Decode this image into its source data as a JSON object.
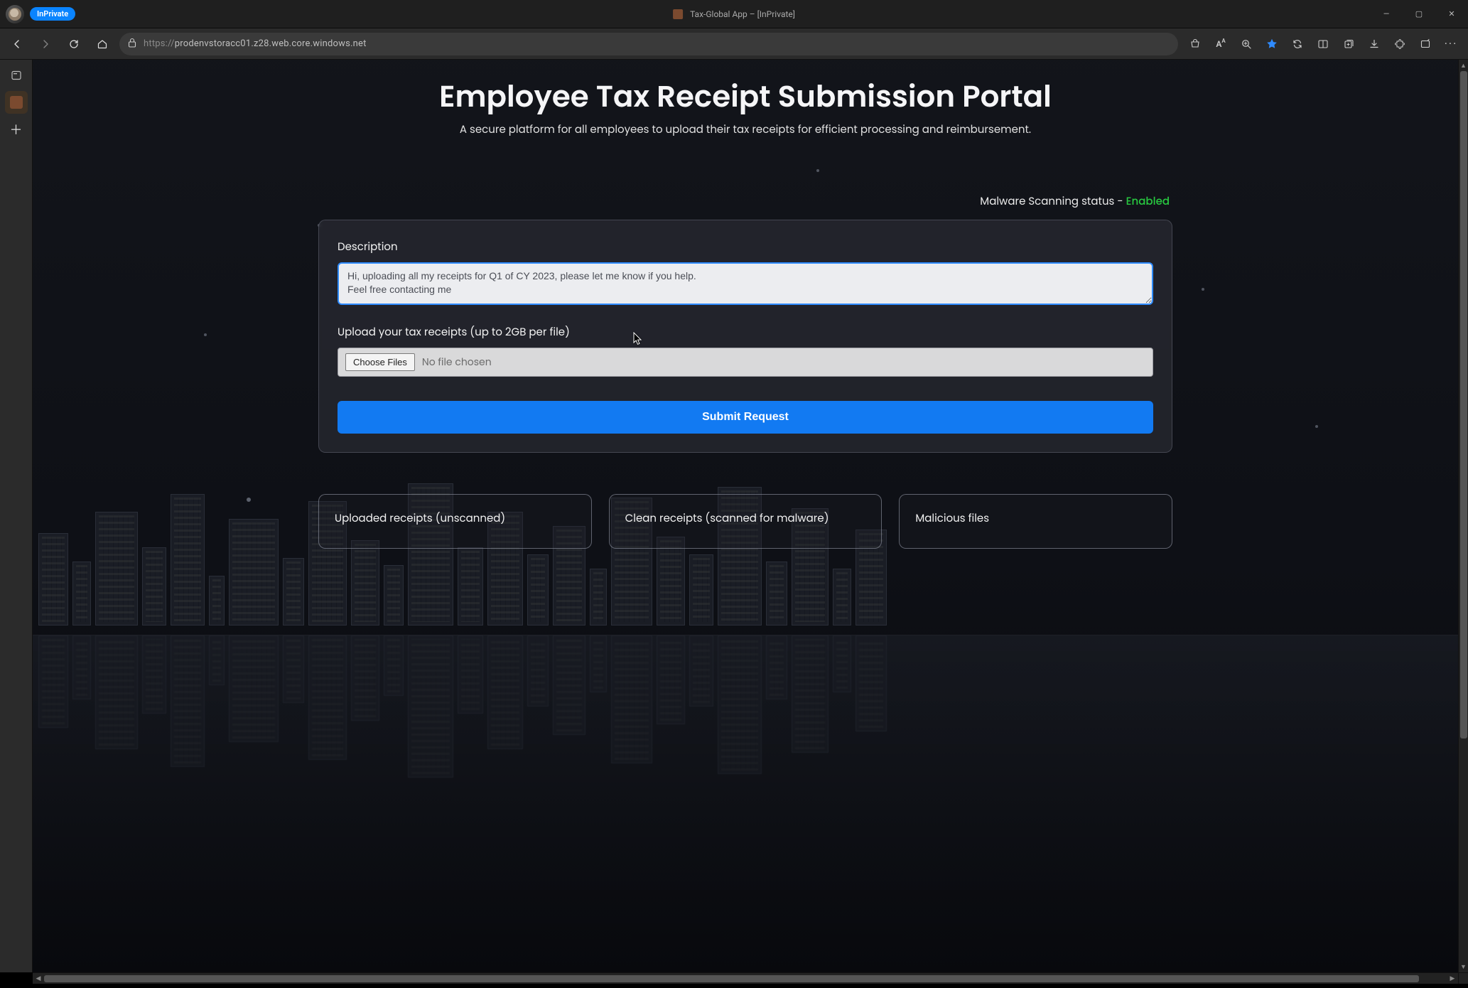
{
  "window": {
    "inprivate_label": "InPrivate",
    "tab_title": "Tax-Global App – [InPrivate]",
    "controls": {
      "minimize": "—",
      "maximize": "▢",
      "close": "✕"
    }
  },
  "toolbar": {
    "address_protocol": "https://",
    "address_host": "prodenvstoracc01.z28.web.core.windows.net"
  },
  "page": {
    "title": "Employee Tax Receipt Submission Portal",
    "subtitle": "A secure platform for all employees to upload their tax receipts for efficient processing and reimbursement.",
    "scan_label": "Malware Scanning status - ",
    "scan_value": "Enabled",
    "form": {
      "description_label": "Description",
      "description_value": "Hi, uploading all my receipts for Q1 of CY 2023, please let me know if you help.\nFeel free contacting me",
      "upload_label": "Upload your tax receipts (up to 2GB per file)",
      "choose_files_label": "Choose Files",
      "no_file_text": "No file chosen",
      "submit_label": "Submit Request"
    },
    "panels": {
      "uploaded": "Uploaded receipts (unscanned)",
      "clean": "Clean receipts (scanned for malware)",
      "malicious": "Malicious files"
    }
  }
}
